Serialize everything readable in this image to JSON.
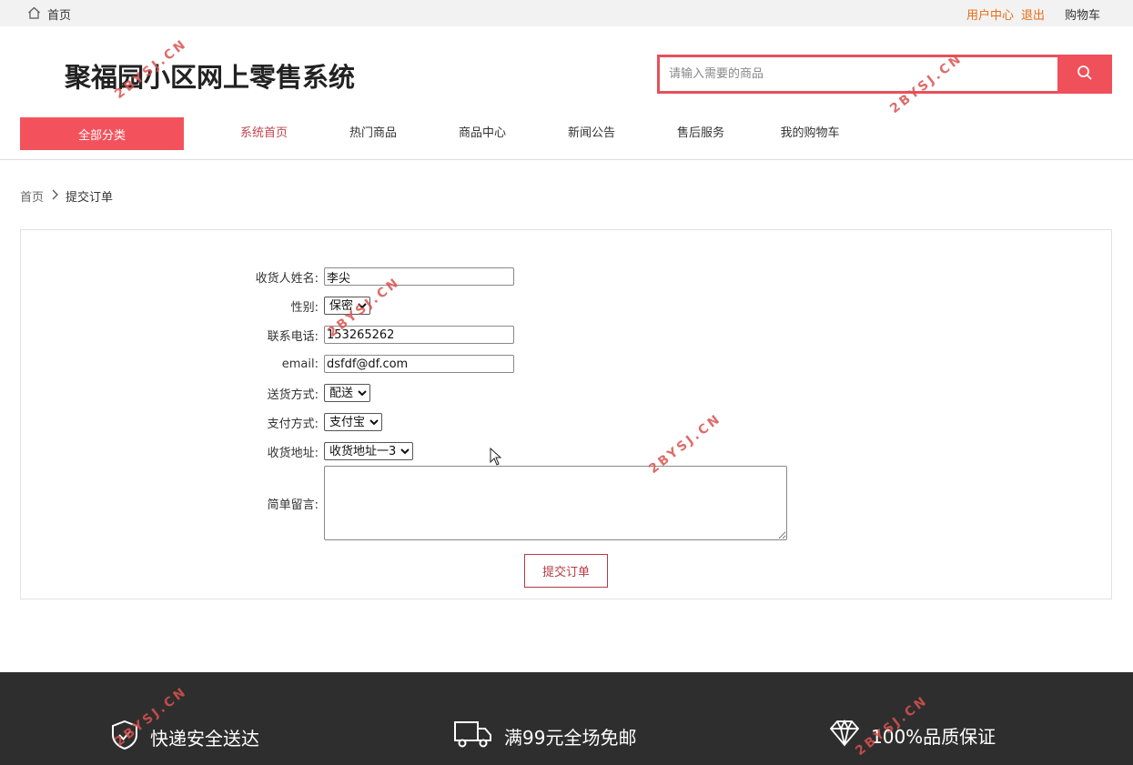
{
  "topbar": {
    "home_label": "首页",
    "user_center": "用户中心",
    "logout": "退出",
    "cart": "购物车"
  },
  "header": {
    "site_title": "聚福园小区网上零售系统",
    "search_placeholder": "请输入需要的商品",
    "search_icon": "search-icon"
  },
  "nav": {
    "category_button": "全部分类",
    "items": [
      "系统首页",
      "热门商品",
      "商品中心",
      "新闻公告",
      "售后服务",
      "我的购物车"
    ],
    "active_index": 0
  },
  "breadcrumb": {
    "home": "首页",
    "current": "提交订单"
  },
  "form": {
    "name_label": "收货人姓名:",
    "name_value": "李尖",
    "gender_label": "性别:",
    "gender_value": "保密",
    "phone_label": "联系电话:",
    "phone_value": "153265262",
    "email_label": "email:",
    "email_value": "dsfdf@df.com",
    "delivery_label": "送货方式:",
    "delivery_value": "配送",
    "payment_label": "支付方式:",
    "payment_value": "支付宝",
    "address_label": "收货地址:",
    "address_value": "收货地址一3",
    "message_label": "简单留言:",
    "message_value": "",
    "submit_label": "提交订单"
  },
  "footer": {
    "features": [
      {
        "icon": "shield-icon",
        "label": "快递安全送达"
      },
      {
        "icon": "truck-icon",
        "label": "满99元全场免邮"
      },
      {
        "icon": "diamond-icon",
        "label": "100%品质保证"
      }
    ]
  },
  "watermark": "2BYSJ.CN",
  "colors": {
    "accent": "#f3525c",
    "link_orange": "#e86c16",
    "footer_bg": "#2e2e2e",
    "submit_border": "#b33a45"
  }
}
